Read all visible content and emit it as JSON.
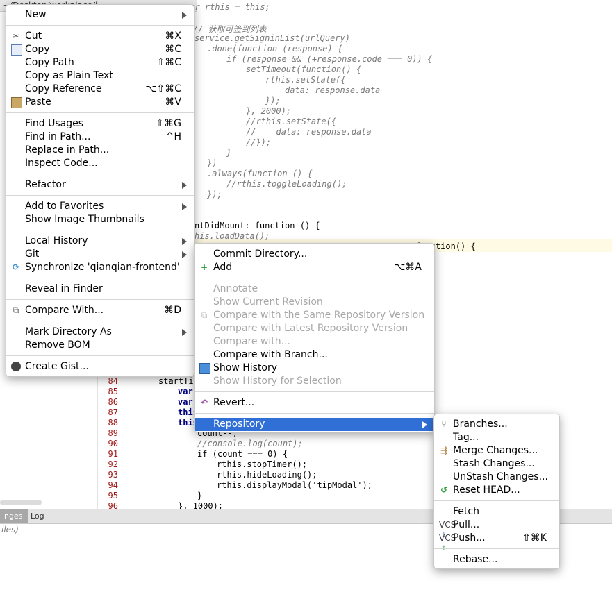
{
  "editor": {
    "path_fragment": "~/Desktop/workplace/i",
    "lines": [
      "var rthis = this;",
      "// 获取可签到列表",
      "service.getSigninList(urlQuery)",
      ".done(function (response) {",
      "if (response && (+response.code === 0)) {",
      "setTimeout(function() {",
      "rthis.setState({",
      "data: response.data",
      "});",
      "}, 2000);",
      "//rthis.setState({",
      "//    data: response.data",
      "//});",
      "}",
      "})",
      ".always(function () {",
      "//rthis.toggleLoading();",
      "});",
      "ntDidMount: function () {",
      "his.loadData();",
      "function() {"
    ],
    "lower_lines": [
      {
        "num": "84",
        "code": "startTim"
      },
      {
        "num": "85",
        "code": "var"
      },
      {
        "num": "86",
        "code": "var"
      },
      {
        "num": "87",
        "code": "this"
      },
      {
        "num": "88",
        "code": "this"
      },
      {
        "num": "89",
        "code": "count--;"
      },
      {
        "num": "90",
        "code": "//console.log(count);"
      },
      {
        "num": "91",
        "code": "if (count === 0) {"
      },
      {
        "num": "92",
        "code": "rthis.stopTimer();"
      },
      {
        "num": "93",
        "code": "rthis.hideLoading();"
      },
      {
        "num": "94",
        "code": "rthis.displayModal('tipModal');"
      },
      {
        "num": "95",
        "code": "}"
      },
      {
        "num": "96",
        "code": "}, 1000);"
      }
    ]
  },
  "bottom_panel": {
    "tab_changes": "nges",
    "tab_log": "Log",
    "status": "iles)"
  },
  "context_menu": {
    "new": "New",
    "cut": "Cut",
    "cut_sc": "⌘X",
    "copy": "Copy",
    "copy_sc": "⌘C",
    "copy_path": "Copy Path",
    "copy_path_sc": "⇧⌘C",
    "copy_plain": "Copy as Plain Text",
    "copy_ref": "Copy Reference",
    "copy_ref_sc": "⌥⇧⌘C",
    "paste": "Paste",
    "paste_sc": "⌘V",
    "find_usages": "Find Usages",
    "find_usages_sc": "⇧⌘G",
    "find_in_path": "Find in Path...",
    "find_in_path_sc": "^H",
    "replace_in_path": "Replace in Path...",
    "inspect_code": "Inspect Code...",
    "refactor": "Refactor",
    "add_favorites": "Add to Favorites",
    "show_thumbnails": "Show Image Thumbnails",
    "local_history": "Local History",
    "git": "Git",
    "synchronize": "Synchronize 'qianqian-frontend'",
    "reveal": "Reveal in Finder",
    "compare_with": "Compare With...",
    "compare_with_sc": "⌘D",
    "mark_dir": "Mark Directory As",
    "remove_bom": "Remove BOM",
    "create_gist": "Create Gist..."
  },
  "git_menu": {
    "commit_dir": "Commit Directory...",
    "add": "Add",
    "add_sc": "⌥⌘A",
    "annotate": "Annotate",
    "show_current_rev": "Show Current Revision",
    "compare_same_repo": "Compare with the Same Repository Version",
    "compare_latest_repo": "Compare with Latest Repository Version",
    "compare_with": "Compare with...",
    "compare_branch": "Compare with Branch...",
    "show_history": "Show History",
    "show_history_sel": "Show History for Selection",
    "revert": "Revert...",
    "repository": "Repository"
  },
  "repo_menu": {
    "branches": "Branches...",
    "tag": "Tag...",
    "merge": "Merge Changes...",
    "stash": "Stash Changes...",
    "unstash": "UnStash Changes...",
    "reset_head": "Reset HEAD...",
    "fetch": "Fetch",
    "pull": "Pull...",
    "push": "Push...",
    "push_sc": "⇧⌘K",
    "rebase": "Rebase...",
    "vcs_label": "VCS"
  },
  "colors": {
    "selection": "#2f6fd6",
    "disabled_text": "#a8a8a8",
    "line_number": "#a01818"
  }
}
